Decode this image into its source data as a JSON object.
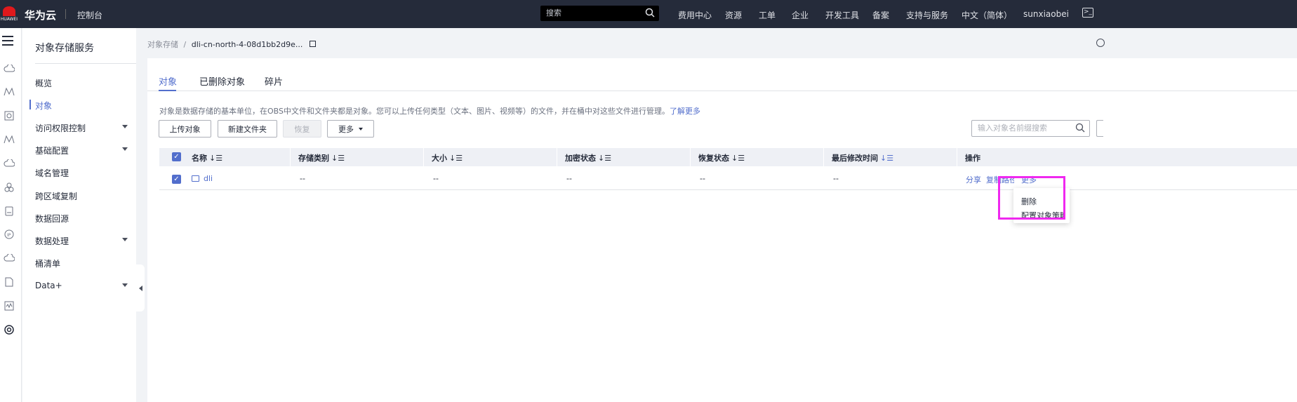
{
  "topbar": {
    "logo_text": "HUAWEI",
    "brand": "华为云",
    "console": "控制台",
    "search_placeholder": "搜索",
    "nav": [
      "费用中心",
      "资源",
      "工单",
      "企业",
      "开发工具",
      "备案",
      "支持与服务",
      "中文（简体）",
      "sunxiaobei"
    ]
  },
  "sidebar": {
    "title": "对象存储服务",
    "items": [
      {
        "label": "概览",
        "caret": false
      },
      {
        "label": "对象",
        "caret": false,
        "active": true
      },
      {
        "label": "访问权限控制",
        "caret": true
      },
      {
        "label": "基础配置",
        "caret": true
      },
      {
        "label": "域名管理",
        "caret": false
      },
      {
        "label": "跨区域复制",
        "caret": false
      },
      {
        "label": "数据回源",
        "caret": false
      },
      {
        "label": "数据处理",
        "caret": true
      },
      {
        "label": "桶清单",
        "caret": false
      },
      {
        "label": "Data+",
        "caret": true
      }
    ]
  },
  "breadcrumb": {
    "root": "对象存储",
    "separator": "/",
    "current": "dli-cn-north-4-08d1bb2d9e..."
  },
  "tabs": [
    "对象",
    "已删除对象",
    "碎片"
  ],
  "description": {
    "text": "对象是数据存储的基本单位，在OBS中文件和文件夹都是对象。您可以上传任何类型（文本、图片、视频等）的文件，并在桶中对这些文件进行管理。",
    "link": "了解更多"
  },
  "toolbar": {
    "upload": "上传对象",
    "new_folder": "新建文件夹",
    "restore": "恢复",
    "more": "更多",
    "search_placeholder": "输入对象名前缀搜索"
  },
  "table": {
    "columns": [
      "名称",
      "存储类别",
      "大小",
      "加密状态",
      "恢复状态",
      "最后修改时间",
      "操作"
    ],
    "rows": [
      {
        "name": "dli",
        "storage_class": "--",
        "size": "--",
        "encryption": "--",
        "restore": "--",
        "modified": "--",
        "actions": [
          "分享",
          "复制路径",
          "更多"
        ]
      }
    ]
  },
  "dropdown": {
    "items": [
      "删除",
      "配置对象策略"
    ]
  },
  "colors": {
    "topbar": "#252b3a",
    "accent": "#526ecc",
    "highlight": "#ef28ef"
  }
}
